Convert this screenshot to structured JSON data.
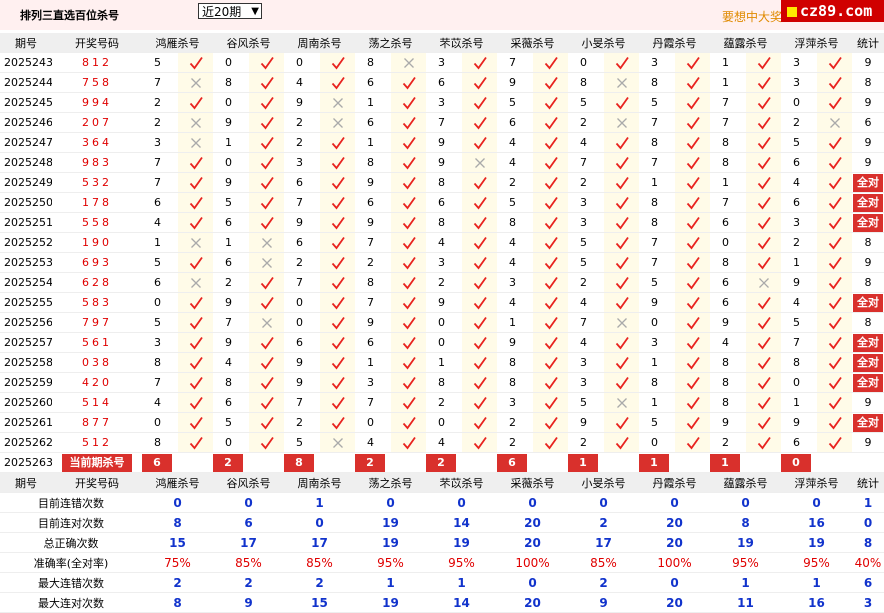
{
  "page": {
    "title": "排列三直选百位杀号",
    "period_select": "近20期",
    "ad_text": "要想中大奖",
    "logo_text": "cz89.com"
  },
  "columns": [
    "期号",
    "开奖号码",
    "鸿雁杀号",
    "谷风杀号",
    "周南杀号",
    "荡之杀号",
    "芣苡杀号",
    "采薇杀号",
    "小旻杀号",
    "丹霞杀号",
    "蕴露杀号",
    "浮萍杀号",
    "统计"
  ],
  "rows": [
    {
      "issue": "2025243",
      "draw": "812",
      "kills": [
        5,
        0,
        0,
        8,
        3,
        7,
        0,
        3,
        1,
        3
      ],
      "ok": [
        1,
        1,
        1,
        0,
        1,
        1,
        1,
        1,
        1,
        1
      ],
      "stat": "9"
    },
    {
      "issue": "2025244",
      "draw": "758",
      "kills": [
        7,
        8,
        4,
        6,
        6,
        9,
        8,
        8,
        1,
        3
      ],
      "ok": [
        0,
        1,
        1,
        1,
        1,
        1,
        0,
        1,
        1,
        1
      ],
      "stat": "8"
    },
    {
      "issue": "2025245",
      "draw": "994",
      "kills": [
        2,
        0,
        9,
        1,
        3,
        5,
        5,
        5,
        7,
        0
      ],
      "ok": [
        1,
        1,
        0,
        1,
        1,
        1,
        1,
        1,
        1,
        1
      ],
      "stat": "9"
    },
    {
      "issue": "2025246",
      "draw": "207",
      "kills": [
        2,
        9,
        2,
        6,
        7,
        6,
        2,
        7,
        7,
        2
      ],
      "ok": [
        0,
        1,
        0,
        1,
        1,
        1,
        0,
        1,
        1,
        0
      ],
      "stat": "6"
    },
    {
      "issue": "2025247",
      "draw": "364",
      "kills": [
        3,
        1,
        2,
        1,
        9,
        4,
        4,
        8,
        8,
        5
      ],
      "ok": [
        0,
        1,
        1,
        1,
        1,
        1,
        1,
        1,
        1,
        1
      ],
      "stat": "9"
    },
    {
      "issue": "2025248",
      "draw": "983",
      "kills": [
        7,
        0,
        3,
        8,
        9,
        4,
        7,
        7,
        8,
        6
      ],
      "ok": [
        1,
        1,
        1,
        1,
        0,
        1,
        1,
        1,
        1,
        1
      ],
      "stat": "9"
    },
    {
      "issue": "2025249",
      "draw": "532",
      "kills": [
        7,
        9,
        6,
        9,
        8,
        2,
        2,
        1,
        1,
        4
      ],
      "ok": [
        1,
        1,
        1,
        1,
        1,
        1,
        1,
        1,
        1,
        1
      ],
      "stat": "全对"
    },
    {
      "issue": "2025250",
      "draw": "178",
      "kills": [
        6,
        5,
        7,
        6,
        6,
        5,
        3,
        8,
        7,
        6
      ],
      "ok": [
        1,
        1,
        1,
        1,
        1,
        1,
        1,
        1,
        1,
        1
      ],
      "stat": "全对"
    },
    {
      "issue": "2025251",
      "draw": "558",
      "kills": [
        4,
        6,
        9,
        9,
        8,
        8,
        3,
        8,
        6,
        3
      ],
      "ok": [
        1,
        1,
        1,
        1,
        1,
        1,
        1,
        1,
        1,
        1
      ],
      "stat": "全对"
    },
    {
      "issue": "2025252",
      "draw": "190",
      "kills": [
        1,
        1,
        6,
        7,
        4,
        4,
        5,
        7,
        0,
        2
      ],
      "ok": [
        0,
        0,
        1,
        1,
        1,
        1,
        1,
        1,
        1,
        1
      ],
      "stat": "8"
    },
    {
      "issue": "2025253",
      "draw": "693",
      "kills": [
        5,
        6,
        2,
        2,
        3,
        4,
        5,
        7,
        8,
        1
      ],
      "ok": [
        1,
        0,
        1,
        1,
        1,
        1,
        1,
        1,
        1,
        1
      ],
      "stat": "9"
    },
    {
      "issue": "2025254",
      "draw": "628",
      "kills": [
        6,
        2,
        7,
        8,
        2,
        3,
        2,
        5,
        6,
        9
      ],
      "ok": [
        0,
        1,
        1,
        1,
        1,
        1,
        1,
        1,
        0,
        1
      ],
      "stat": "8"
    },
    {
      "issue": "2025255",
      "draw": "583",
      "kills": [
        0,
        9,
        0,
        7,
        9,
        4,
        4,
        9,
        6,
        4
      ],
      "ok": [
        1,
        1,
        1,
        1,
        1,
        1,
        1,
        1,
        1,
        1
      ],
      "stat": "全对"
    },
    {
      "issue": "2025256",
      "draw": "797",
      "kills": [
        5,
        7,
        0,
        9,
        0,
        1,
        7,
        0,
        9,
        5
      ],
      "ok": [
        1,
        0,
        1,
        1,
        1,
        1,
        0,
        1,
        1,
        1
      ],
      "stat": "8"
    },
    {
      "issue": "2025257",
      "draw": "561",
      "kills": [
        3,
        9,
        6,
        6,
        0,
        9,
        4,
        3,
        4,
        7
      ],
      "ok": [
        1,
        1,
        1,
        1,
        1,
        1,
        1,
        1,
        1,
        1
      ],
      "stat": "全对"
    },
    {
      "issue": "2025258",
      "draw": "038",
      "kills": [
        8,
        4,
        9,
        1,
        1,
        8,
        3,
        1,
        8,
        8
      ],
      "ok": [
        1,
        1,
        1,
        1,
        1,
        1,
        1,
        1,
        1,
        1
      ],
      "stat": "全对"
    },
    {
      "issue": "2025259",
      "draw": "420",
      "kills": [
        7,
        8,
        9,
        3,
        8,
        8,
        3,
        8,
        8,
        0
      ],
      "ok": [
        1,
        1,
        1,
        1,
        1,
        1,
        1,
        1,
        1,
        1
      ],
      "stat": "全对"
    },
    {
      "issue": "2025260",
      "draw": "514",
      "kills": [
        4,
        6,
        7,
        7,
        2,
        3,
        5,
        1,
        8,
        1
      ],
      "ok": [
        1,
        1,
        1,
        1,
        1,
        1,
        0,
        1,
        1,
        1
      ],
      "stat": "9"
    },
    {
      "issue": "2025261",
      "draw": "877",
      "kills": [
        0,
        5,
        2,
        0,
        0,
        2,
        9,
        5,
        9,
        9
      ],
      "ok": [
        1,
        1,
        1,
        1,
        1,
        1,
        1,
        1,
        1,
        1
      ],
      "stat": "全对"
    },
    {
      "issue": "2025262",
      "draw": "512",
      "kills": [
        8,
        0,
        5,
        4,
        4,
        2,
        2,
        0,
        2,
        6
      ],
      "ok": [
        1,
        1,
        0,
        1,
        1,
        1,
        1,
        1,
        1,
        1
      ],
      "stat": "9"
    }
  ],
  "current": {
    "issue": "2025263",
    "label": "当前期杀号",
    "kills": [
      6,
      2,
      8,
      2,
      2,
      6,
      1,
      1,
      1,
      0
    ]
  },
  "summary_header": [
    "期号",
    "开奖号码",
    "鸿雁杀号",
    "谷风杀号",
    "周南杀号",
    "荡之杀号",
    "芣苡杀号",
    "采薇杀号",
    "小旻杀号",
    "丹霞杀号",
    "蕴露杀号",
    "浮萍杀号",
    "统计"
  ],
  "summary": [
    {
      "label": "目前连错次数",
      "type": "int",
      "values": [
        "0",
        "0",
        "1",
        "0",
        "0",
        "0",
        "0",
        "0",
        "0",
        "0",
        "1"
      ]
    },
    {
      "label": "目前连对次数",
      "type": "int",
      "values": [
        "8",
        "6",
        "0",
        "19",
        "14",
        "20",
        "2",
        "20",
        "8",
        "16",
        "0"
      ]
    },
    {
      "label": "总正确次数",
      "type": "int",
      "values": [
        "15",
        "17",
        "17",
        "19",
        "19",
        "20",
        "17",
        "20",
        "19",
        "19",
        "8"
      ]
    },
    {
      "label": "准确率(全对率)",
      "type": "pct",
      "values": [
        "75%",
        "85%",
        "85%",
        "95%",
        "95%",
        "100%",
        "85%",
        "100%",
        "95%",
        "95%",
        "40%"
      ]
    },
    {
      "label": "最大连错次数",
      "type": "int",
      "values": [
        "2",
        "2",
        "2",
        "1",
        "1",
        "0",
        "2",
        "0",
        "1",
        "1",
        "6"
      ]
    },
    {
      "label": "最大连对次数",
      "type": "int",
      "values": [
        "8",
        "9",
        "15",
        "19",
        "14",
        "20",
        "9",
        "20",
        "11",
        "16",
        "3"
      ]
    }
  ],
  "icons": {
    "correct": "check-icon",
    "wrong": "cross-icon"
  },
  "colors": {
    "accent": "#d9302c",
    "header_bg": "#efefef",
    "mark_bg": "#fffbe8",
    "draw_number": "#e00000",
    "stat_blue": "#1133cc"
  }
}
